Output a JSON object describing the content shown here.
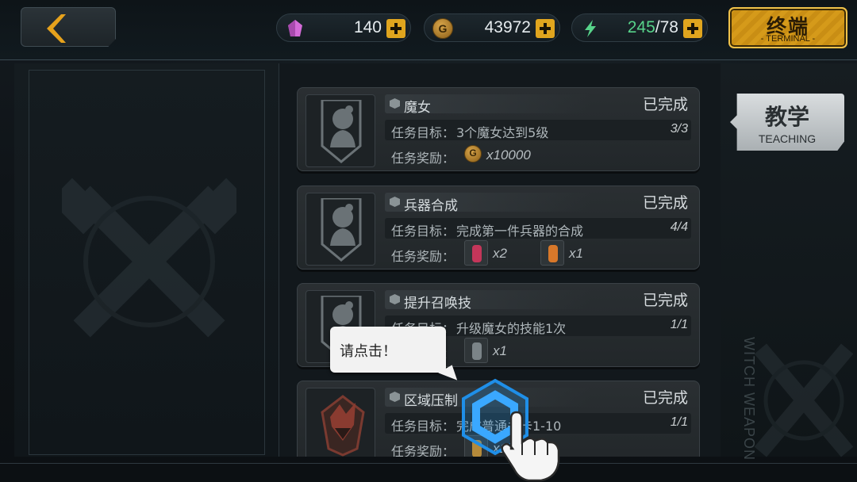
{
  "header": {
    "crystals": "140",
    "gold": "43972",
    "energy_current": "245",
    "energy_max": "/78",
    "gold_icon_letter": "G",
    "terminal_cn": "终端",
    "terminal_en": "- TERMINAL -"
  },
  "side": {
    "teaching_cn": "教学",
    "teaching_en": "TEACHING",
    "watermark": "WITCH WEAPON"
  },
  "labels": {
    "goal": "任务目标：",
    "reward": "任务奖励："
  },
  "tasks": [
    {
      "name": "魔女",
      "status": "已完成",
      "goal": "3个魔女达到5级",
      "progress": "3/3",
      "rewards": [
        {
          "icon": "gold-coin-icon",
          "amount": "x10000"
        }
      ]
    },
    {
      "name": "兵器合成",
      "status": "已完成",
      "goal": "完成第一件兵器的合成",
      "progress": "4/4",
      "rewards": [
        {
          "icon": "exp-potion-red-icon",
          "amount": "x2"
        },
        {
          "icon": "exp-potion-orange-icon",
          "amount": "x1"
        }
      ]
    },
    {
      "name": "提升召唤技",
      "status": "已完成",
      "goal": "升级魔女的技能1次",
      "progress": "1/1",
      "rewards": [
        {
          "icon": "item-icon",
          "amount": "x1"
        }
      ]
    },
    {
      "name": "区域压制",
      "status": "已完成",
      "goal": "完成普通关卡1-10",
      "progress": "1/1",
      "rewards": [
        {
          "icon": "item-icon",
          "amount": "x1"
        }
      ]
    }
  ],
  "tutorial": {
    "hint": "请点击！"
  },
  "colors": {
    "accent_gold": "#e0a51e",
    "energy_green": "#57d38a",
    "crystal_pink": "#d46bd8"
  }
}
